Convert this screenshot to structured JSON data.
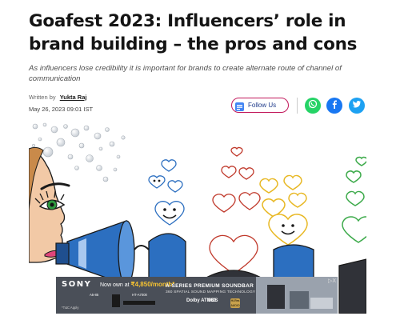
{
  "article": {
    "title": "Goafest 2023: Influencers’ role in brand building – the pros and cons",
    "subtitle": "As influencers lose credibility it is important for brands to create alternate route of channel of communication",
    "written_by_label": "Written by",
    "author": "Yukta Raj",
    "date": "May 26, 2023 09:01 IST"
  },
  "actions": {
    "follow_label": "Follow Us"
  },
  "ad": {
    "brand": "SONY",
    "offer_prefix": "Now own at",
    "offer_price": "₹4,850/month*",
    "model_line": "A-SERIES PREMIUM SOUNDBAR",
    "tagline": "360 SPATIAL SOUND MAPPING TECHNOLOGY",
    "apply": "*T&C Apply",
    "product_a": "A5-85",
    "product_b": "HT-A7000",
    "badge_dolby": "Dolby ATMOS",
    "badge_360": "360",
    "badge_hires": "Hi-Res AUDIO",
    "close": "▷X"
  },
  "colors": {
    "follow_border": "#c2185b",
    "whatsapp": "#25d366",
    "facebook": "#1877f2",
    "twitter": "#1da1f2",
    "megaphone": "#2c6fc0"
  },
  "icons": [
    "google-news-icon",
    "whatsapp-icon",
    "facebook-icon",
    "twitter-icon"
  ]
}
